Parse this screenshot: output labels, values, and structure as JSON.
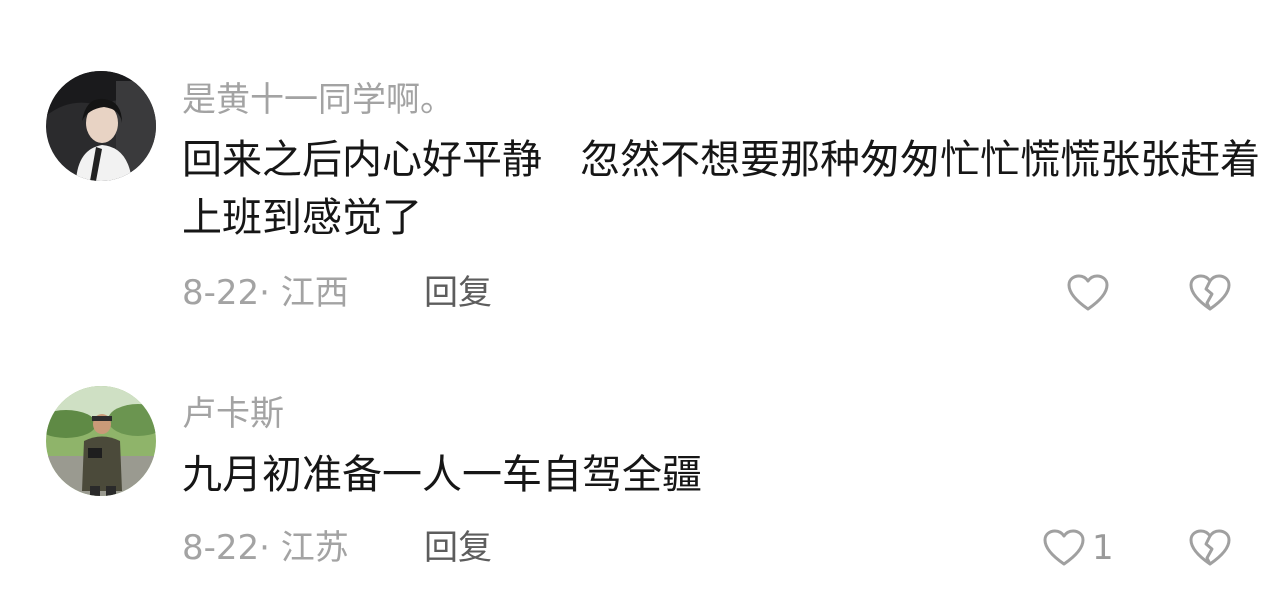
{
  "comments": [
    {
      "username": "是黄十一同学啊。",
      "text": "回来之后内心好平静   忽然不想要那种匆匆忙忙慌慌张张赶着上班到感觉了",
      "meta": "8-22· 江西",
      "reply_label": "回复",
      "like_count": "",
      "avatar_icon": "user-avatar-woman",
      "like_icon": "heart-outline-icon",
      "dislike_icon": "broken-heart-icon"
    },
    {
      "username": "卢卡斯",
      "text": "九月初准备一人一车自驾全疆",
      "meta": "8-22· 江苏",
      "reply_label": "回复",
      "like_count": "1",
      "avatar_icon": "user-avatar-photographer",
      "like_icon": "heart-outline-icon",
      "dislike_icon": "broken-heart-icon"
    }
  ],
  "colors": {
    "username": "#a3a3a3",
    "text": "#161616",
    "meta": "#a3a3a3",
    "reply": "#5d5d5d",
    "icon": "#a0a0a0"
  }
}
